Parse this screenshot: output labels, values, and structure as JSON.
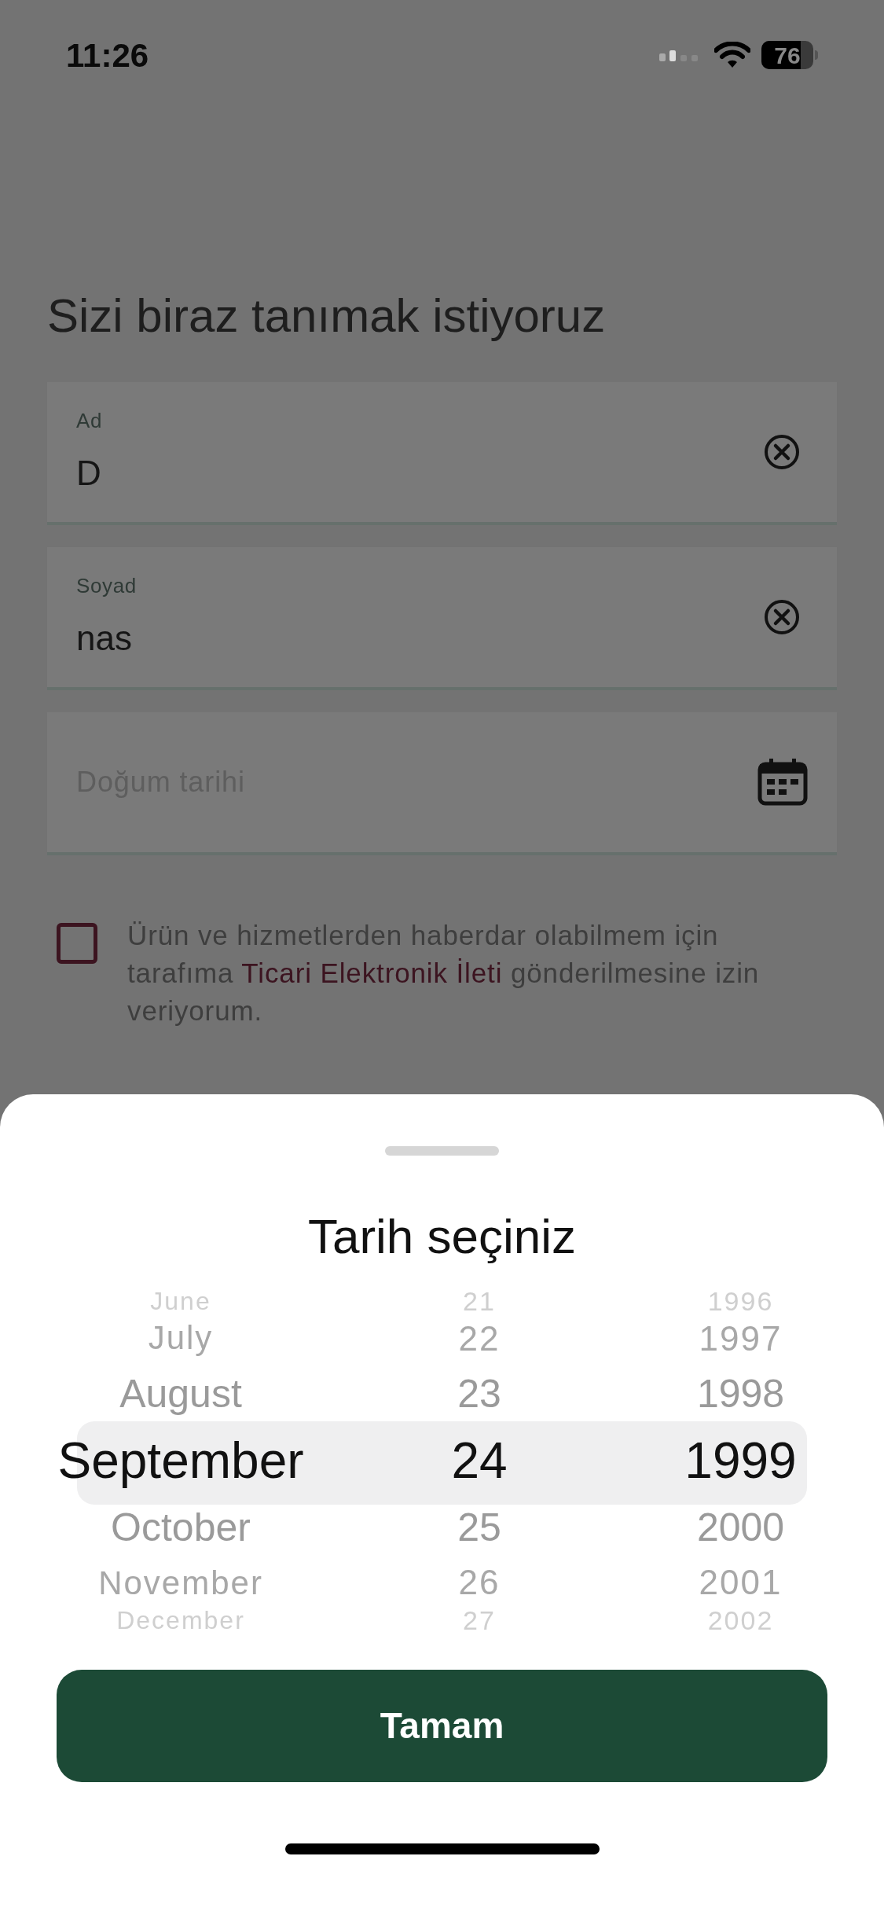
{
  "status_bar": {
    "time": "11:26",
    "battery": "76"
  },
  "title": "Sizi biraz tanımak istiyoruz",
  "fields": [
    {
      "kind": "text",
      "label": "Ad",
      "value": "D"
    },
    {
      "kind": "text",
      "label": "Soyad",
      "value": "nas"
    },
    {
      "kind": "date",
      "placeholder": "Doğum tarihi"
    }
  ],
  "consent": {
    "checked": false,
    "text": "Ürün ve hizmetlerden haberdar olabilmem için tarafıma ",
    "link": "Ticari Elektronik İleti",
    "text_after": " gönderilmesine izin veriyorum."
  },
  "sheet": {
    "title": "Tarih seçiniz",
    "columns": [
      {
        "items": [
          {
            "label": "June",
            "selected": false
          },
          {
            "label": "July",
            "selected": false
          },
          {
            "label": "August",
            "selected": false
          },
          {
            "label": "September",
            "selected": true
          },
          {
            "label": "October",
            "selected": false
          },
          {
            "label": "November",
            "selected": false
          },
          {
            "label": "December",
            "selected": false
          }
        ]
      },
      {
        "items": [
          {
            "label": "21",
            "selected": false
          },
          {
            "label": "22",
            "selected": false
          },
          {
            "label": "23",
            "selected": false
          },
          {
            "label": "24",
            "selected": true
          },
          {
            "label": "25",
            "selected": false
          },
          {
            "label": "26",
            "selected": false
          },
          {
            "label": "27",
            "selected": false
          }
        ]
      },
      {
        "items": [
          {
            "label": "1996",
            "selected": false
          },
          {
            "label": "1997",
            "selected": false
          },
          {
            "label": "1998",
            "selected": false
          },
          {
            "label": "1999",
            "selected": true
          },
          {
            "label": "2000",
            "selected": false
          },
          {
            "label": "2001",
            "selected": false
          },
          {
            "label": "2002",
            "selected": false
          }
        ]
      }
    ],
    "button": "Tamam"
  }
}
